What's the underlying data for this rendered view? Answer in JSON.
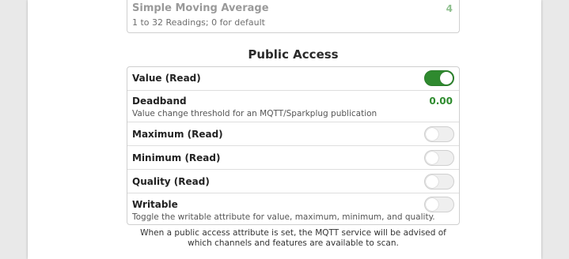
{
  "moving_average": {
    "title": "Simple Moving Average",
    "description": "1 to 32 Readings; 0 for default",
    "value": "4"
  },
  "public_access": {
    "title": "Public Access",
    "rows": [
      {
        "label": "Value (Read)",
        "toggle": true
      },
      {
        "label": "Deadband",
        "description": "Value change threshold for an MQTT/Sparkplug publication",
        "value": "0.00"
      },
      {
        "label": "Maximum (Read)",
        "toggle": false
      },
      {
        "label": "Minimum (Read)",
        "toggle": false
      },
      {
        "label": "Quality (Read)",
        "toggle": false
      },
      {
        "label": "Writable",
        "description": "Toggle the writable attribute for value, maximum, minimum, and quality.",
        "toggle": false
      }
    ],
    "footnote_line1": "When a public access attribute is set, the MQTT service will be advised of",
    "footnote_line2": "which channels and features are available to scan."
  },
  "colors": {
    "toggle_on": "#2f8a2f",
    "toggle_off": "#efefef",
    "value_green": "#2e8b2e"
  }
}
